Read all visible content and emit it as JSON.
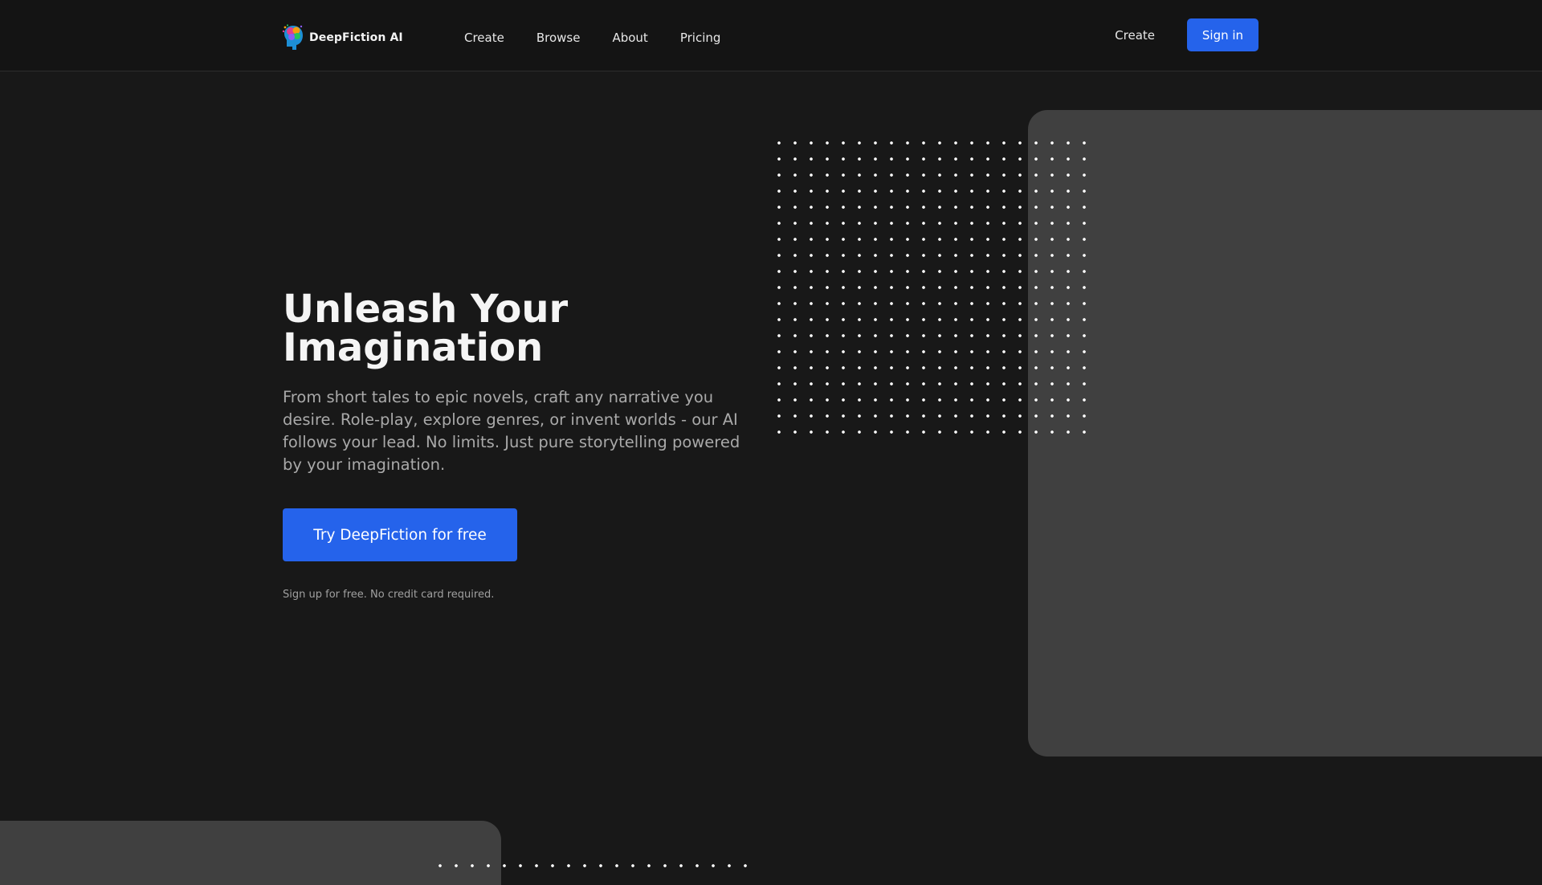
{
  "header": {
    "brand": "DeepFiction AI",
    "nav": [
      {
        "label": "Create"
      },
      {
        "label": "Browse"
      },
      {
        "label": "About"
      },
      {
        "label": "Pricing"
      }
    ],
    "create_label": "Create",
    "signin_label": "Sign in",
    "accent_color": "#2563eb"
  },
  "hero": {
    "title_line1": "Unleash Your",
    "title_line2": "Imagination",
    "description": "From short tales to epic novels, craft any narrative you desire. Role-play, explore genres, or invent worlds - our AI follows your lead. No limits. Just pure storytelling powered by your imagination.",
    "cta_label": "Try DeepFiction for free",
    "note": "Sign up for free. No credit card required."
  },
  "icons": {
    "logo": "brain-head-icon"
  }
}
